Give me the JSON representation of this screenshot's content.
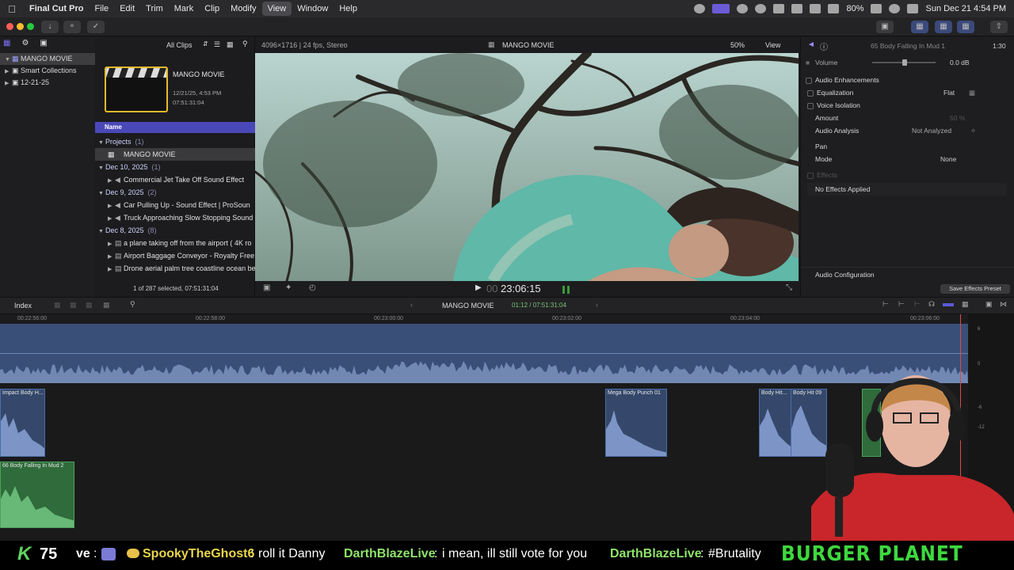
{
  "menubar": {
    "app_name": "Final Cut Pro",
    "menus": [
      "File",
      "Edit",
      "Trim",
      "Mark",
      "Clip",
      "Modify",
      "View",
      "Window",
      "Help"
    ],
    "active_menu": "View",
    "battery": "80%",
    "datetime": "Sun Dec 21  4:54 PM"
  },
  "library": {
    "name": "MANGO MOVIE",
    "items": [
      "Smart Collections",
      "12-21-25"
    ]
  },
  "browser": {
    "filter": "All Clips",
    "thumb_title": "MANGO MOVIE",
    "thumb_date": "12/21/25, 4:53 PM",
    "thumb_duration": "07:51:31:04",
    "column_header": "Name",
    "groups": [
      {
        "label": "Projects",
        "count": "(1)",
        "clips": [
          "MANGO MOVIE"
        ]
      },
      {
        "label": "Dec 10, 2025",
        "count": "(1)",
        "clips": [
          "Commercial Jet Take Off Sound Effect"
        ]
      },
      {
        "label": "Dec 9, 2025",
        "count": "(2)",
        "clips": [
          "Car Pulling Up - Sound Effect  |  ProSoun",
          "Truck Approaching Slow Stopping Sound"
        ]
      },
      {
        "label": "Dec 8, 2025",
        "count": "(8)",
        "clips": [
          "a plane taking off from the airport ( 4K ro",
          "Airport Baggage Conveyor - Royalty Free",
          "Drone aerial palm tree coastline ocean be"
        ]
      }
    ],
    "status": "1 of 287 selected, 07:51:31:04"
  },
  "viewer": {
    "format": "4096×1716 | 24 fps, Stereo",
    "title": "MANGO MOVIE",
    "zoom": "50%",
    "view_menu": "View",
    "timecode": "23:06:15",
    "timecode_prefix": "00"
  },
  "inspector": {
    "clip_name": "65 Body Falling In Mud 1",
    "duration": "1:30",
    "volume_label": "Volume",
    "volume_value": "0.0 dB",
    "section": "Audio Enhancements",
    "rows": [
      {
        "label": "Equalization",
        "value": "Flat"
      },
      {
        "label": "Voice Isolation",
        "value": ""
      },
      {
        "label": "Amount",
        "value": "50 %"
      },
      {
        "label": "Audio Analysis",
        "value": "Not Analyzed"
      },
      {
        "label": "Pan",
        "value": ""
      },
      {
        "label": "Mode",
        "value": "None"
      },
      {
        "label": "Effects",
        "value": ""
      }
    ],
    "no_effects": "No Effects Applied",
    "audio_config": "Audio Configuration",
    "save_preset": "Save Effects Preset"
  },
  "timeline": {
    "index_label": "Index",
    "project": "MANGO MOVIE",
    "position": "01:12 / 07:51:31:04",
    "ruler": [
      "00:22:56:00",
      "00:22:58:00",
      "00:23:00:00",
      "00:23:02:00",
      "00:23:04:00",
      "00:23:06:00"
    ],
    "meter_scale": [
      "6",
      "0",
      "-6",
      "-12"
    ],
    "clips": [
      "Impact Body H...",
      "Mega Body Punch 01",
      "Body Hit...",
      "Body Hit 09",
      "66 Body Falling In Mud 2"
    ]
  },
  "stream": {
    "counter_letter": "K",
    "counter_value": "75",
    "chat": [
      {
        "user": "ve",
        "msg": ""
      },
      {
        "user": "SpookyTheGhost6",
        "msg": "roll it Danny"
      },
      {
        "user": "DarthBlazeLive",
        "msg": "i mean, ill still vote for you"
      },
      {
        "user": "DarthBlazeLive",
        "msg": "#Brutality"
      }
    ],
    "banner": "BURGER PLANET"
  }
}
